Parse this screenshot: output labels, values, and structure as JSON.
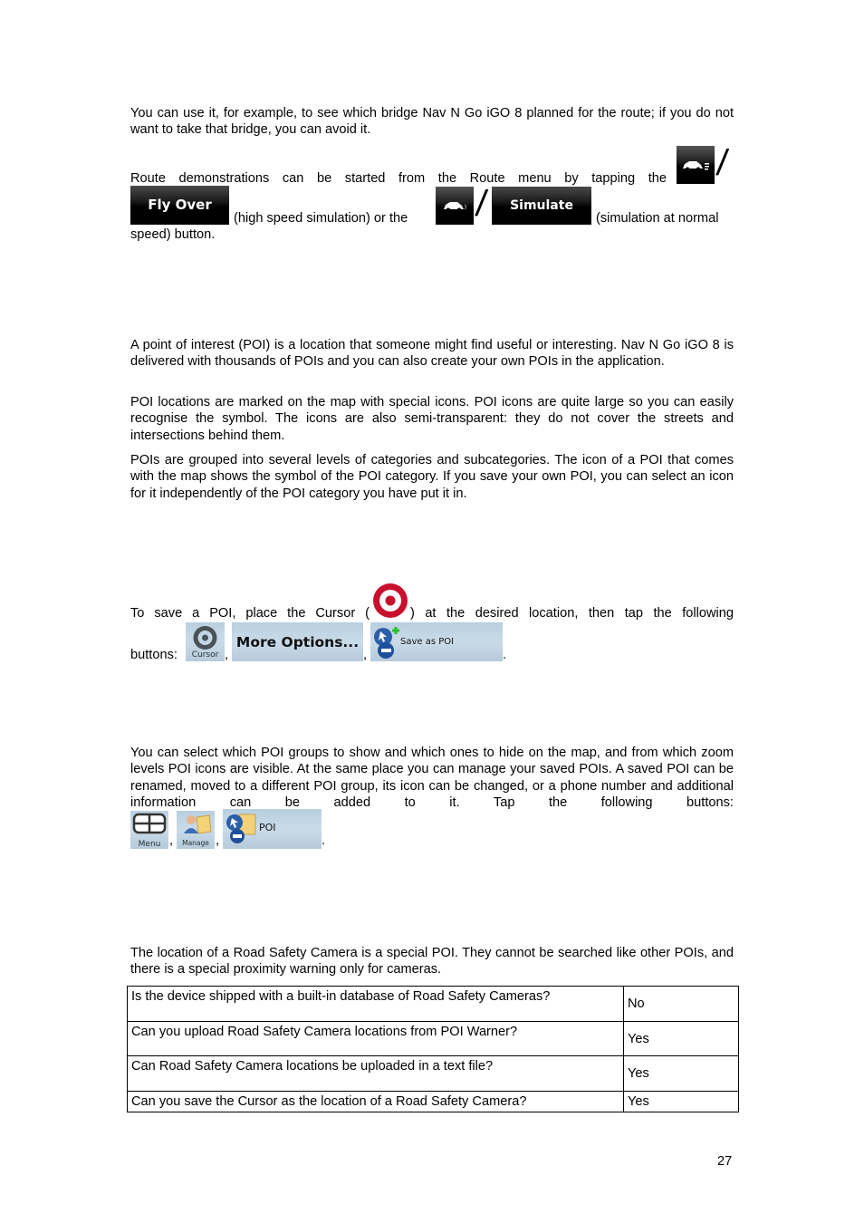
{
  "paragraphs": {
    "bridge": "You can use it, for example, to see which bridge Nav N Go iGO 8 planned for the route; if you do not want to take that bridge, you can avoid it.",
    "demo_line1": "Route demonstrations can be started from the Route menu by tapping the",
    "demo_mid1": "(high speed simulation) or the",
    "demo_mid2": "(simulation at normal",
    "demo_line3": "speed) button.",
    "poi_intro": "A point of interest (POI) is a location that someone might find useful or interesting. Nav N Go iGO 8 is delivered with thousands of POIs and you can also create your own POIs in the application.",
    "poi_icons": "POI locations are marked on the map with special icons. POI icons are quite large so you can easily recognise the symbol. The icons are also semi-transparent: they do not cover the streets and intersections behind them.",
    "poi_groups": "POIs are grouped into several levels of categories and subcategories. The icon of a POI that comes with the map shows the symbol of the POI category. If you save your own POI, you can select an icon for it independently of the POI category you have put it in.",
    "save_before": "To save a POI, place the Cursor (",
    "save_after": ") at the desired location, then tap the following",
    "save_buttons_label": "buttons:",
    "manage": "You can select which POI groups to show and which ones to hide on the map, and from which zoom levels POI icons are visible. At the same place you can manage your saved POIs. A saved POI can be renamed, moved to a different POI group, its icon can be changed, or a phone number and additional information can be added to it. Tap the following buttons:",
    "camera": "The location of a Road Safety Camera is a special POI. They cannot be searched like other POIs, and there is a special proximity warning only for cameras."
  },
  "separators": {
    "comma": ",",
    "period": ".",
    "slash": "/"
  },
  "buttons": {
    "fly_over": "Fly Over",
    "simulate": "Simulate",
    "cursor": "Cursor",
    "more_options": "More Options...",
    "save_as_poi": "Save as POI",
    "menu": "Menu",
    "manage": "Manage",
    "poi": "POI"
  },
  "icons": {
    "fly_over_icon": "car-fast-icon",
    "simulate_icon": "car-icon",
    "cursor_marker": "target-cursor-icon"
  },
  "colors": {
    "cursor_red": "#c8102e",
    "button_blue": "#c3d6e5",
    "dark_button": "#000000"
  },
  "table": {
    "rows": [
      {
        "question": "Is the device shipped with a built-in database of Road Safety Cameras?",
        "answer": "No"
      },
      {
        "question": "Can you upload Road Safety Camera locations from POI Warner?",
        "answer": "Yes"
      },
      {
        "question": "Can Road Safety Camera locations be uploaded in a text file?",
        "answer": "Yes"
      },
      {
        "question": "Can you save the Cursor as the location of a Road Safety Camera?",
        "answer": "Yes"
      }
    ]
  },
  "page_number": "27"
}
